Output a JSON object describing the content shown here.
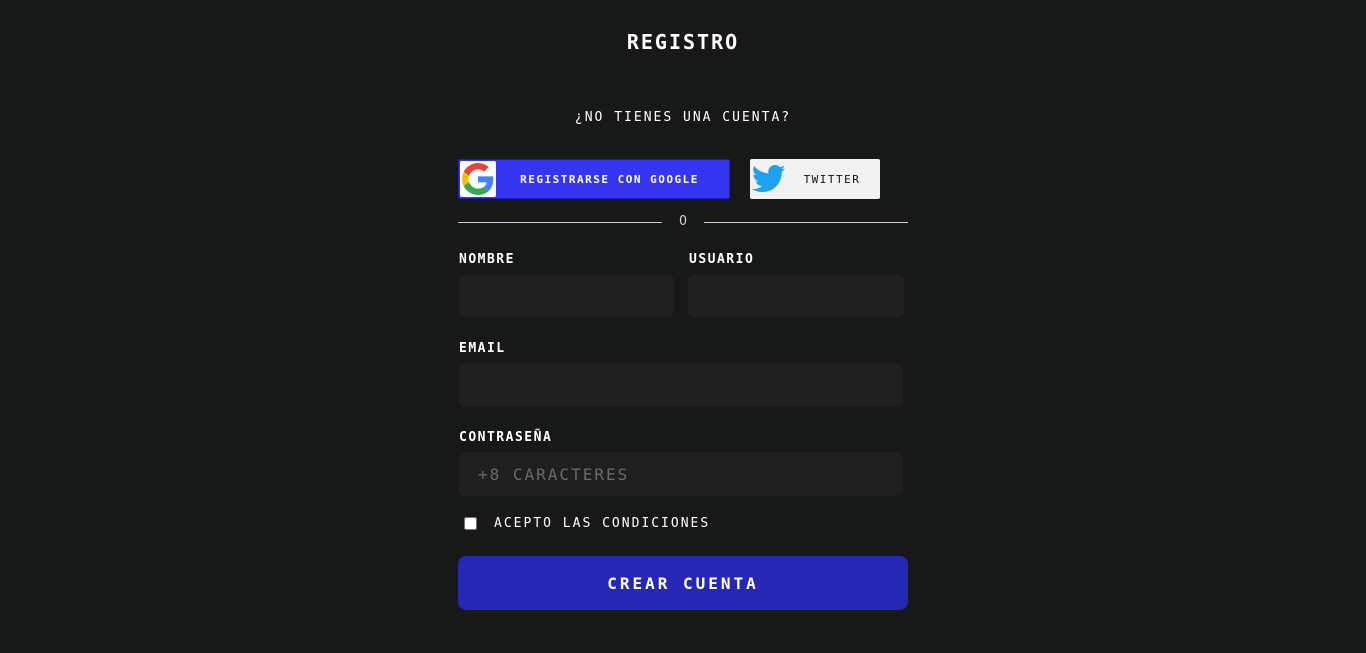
{
  "header": {
    "title": "REGISTRO",
    "subtitle": "¿NO TIENES UNA CUENTA?"
  },
  "social": {
    "google": {
      "label": "REGISTRARSE CON GOOGLE",
      "icon": "google-icon",
      "color": "#3535f0"
    },
    "twitter": {
      "label": "TWITTER",
      "icon": "twitter-icon",
      "color": "#1da1f2"
    }
  },
  "divider": {
    "text": "O"
  },
  "form": {
    "nombre": {
      "label": "NOMBRE",
      "value": "",
      "placeholder": ""
    },
    "usuario": {
      "label": "USUARIO",
      "value": "",
      "placeholder": ""
    },
    "email": {
      "label": "EMAIL",
      "value": "",
      "placeholder": ""
    },
    "password": {
      "label": "CONTRASEÑA",
      "value": "",
      "placeholder": "+8 CARACTERES"
    },
    "terms": {
      "label": "ACEPTO LAS CONDICIONES",
      "checked": false
    },
    "submit_label": "CREAR CUENTA"
  },
  "colors": {
    "background": "#171818",
    "input_bg": "#1f1f1f",
    "primary": "#2727b5"
  }
}
